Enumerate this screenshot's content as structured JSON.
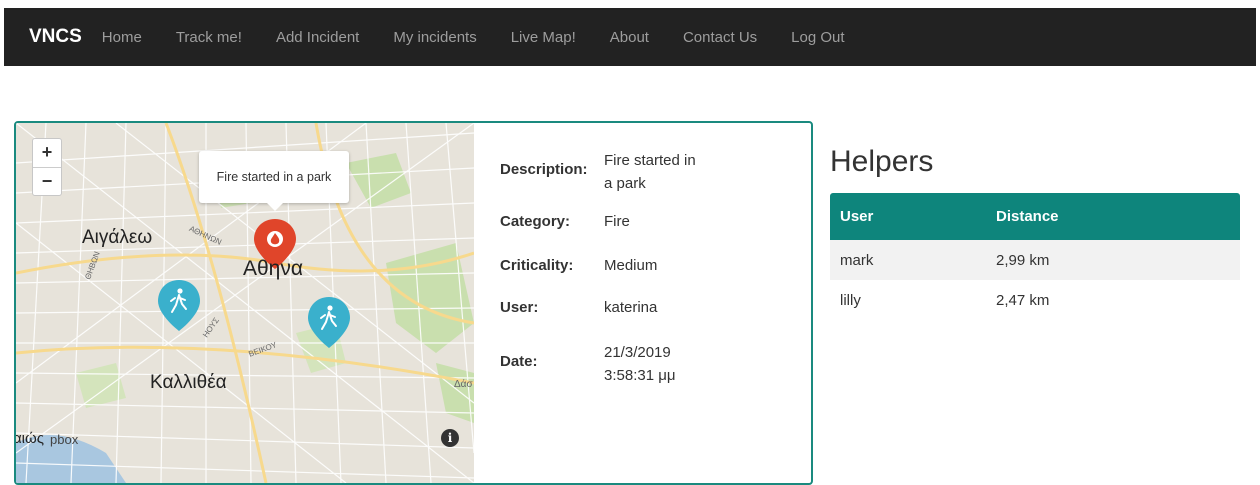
{
  "nav": {
    "brand": "VNCS",
    "items": [
      "Home",
      "Track me!",
      "Add Incident",
      "My incidents",
      "Live Map!",
      "About",
      "Contact Us",
      "Log Out"
    ]
  },
  "map": {
    "zoom_in": "+",
    "zoom_out": "−",
    "popup": "Fire started in a park",
    "labels": {
      "aigaleo": "Αιγάλεω",
      "athina": "Αθηνα",
      "kallithea": "Καλλιθέα",
      "athinon": "ΑΘΗΝΩΝ",
      "theiva": "ΘΗΒΩΝ",
      "ioys": "ΗΟΥΣ",
      "veikoy": "ΒΕΙΚΟΥ",
      "dao": "Δάσ",
      "edge": "αιώς",
      "attribution": "pbox",
      "info": "i"
    },
    "colors": {
      "incident_marker": "#e0452a",
      "helper_marker": "#3ab0cc"
    }
  },
  "incident": {
    "description_label": "Description:",
    "description_line1": "Fire started in",
    "description_line2": "a park",
    "category_label": "Category:",
    "category": "Fire",
    "criticality_label": "Criticality:",
    "criticality": "Medium",
    "user_label": "User:",
    "user": "katerina",
    "date_label": "Date:",
    "date_line1": "21/3/2019",
    "date_line2": "3:58:31 μμ"
  },
  "helpers": {
    "title": "Helpers",
    "headers": [
      "User",
      "Distance"
    ],
    "rows": [
      {
        "user": "mark",
        "distance": "2,99 km"
      },
      {
        "user": "lilly",
        "distance": "2,47 km"
      }
    ]
  }
}
